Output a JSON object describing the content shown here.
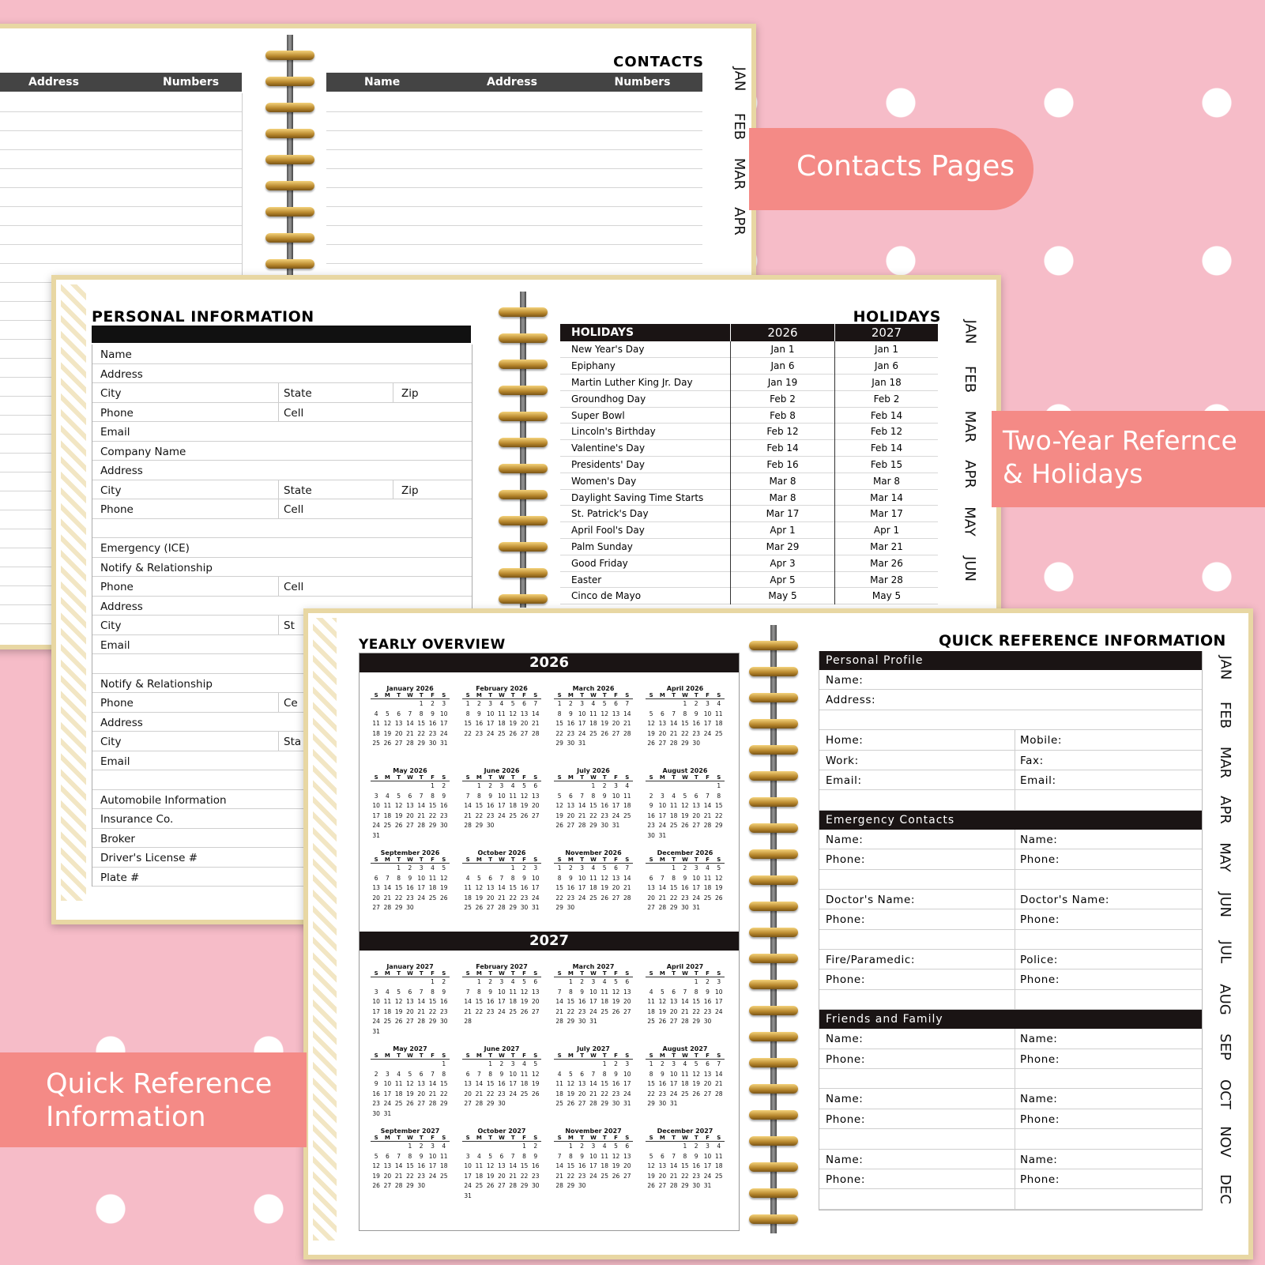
{
  "contacts_page": {
    "title": "CONTACTS",
    "left_headers": [
      "Address",
      "Numbers"
    ],
    "right_headers": [
      "Name",
      "Address",
      "Numbers"
    ]
  },
  "banners": {
    "contacts": "Contacts Pages",
    "holidays_line1": "Two-Year Refernce",
    "holidays_line2": "& Holidays",
    "quick_line1": "Quick Reference",
    "quick_line2": "Information"
  },
  "month_tabs": [
    "JAN",
    "FEB",
    "MAR",
    "APR",
    "MAY",
    "JUN",
    "JUL",
    "AUG",
    "SEP",
    "OCT",
    "NOV",
    "DEC"
  ],
  "personal_info": {
    "title": "PERSONAL INFORMATION",
    "rows": [
      [
        "Name",
        "",
        ""
      ],
      [
        "Address",
        "",
        ""
      ],
      [
        "City",
        "State",
        "Zip"
      ],
      [
        "Phone",
        "Cell",
        ""
      ],
      [
        "Email",
        "",
        ""
      ],
      [
        "Company Name",
        "",
        ""
      ],
      [
        "Address",
        "",
        ""
      ],
      [
        "City",
        "State",
        "Zip"
      ],
      [
        "Phone",
        "Cell",
        ""
      ],
      [
        "",
        "",
        ""
      ],
      [
        "Emergency (ICE)",
        "",
        ""
      ],
      [
        "Notify & Relationship",
        "",
        ""
      ],
      [
        "Phone",
        "Cell",
        ""
      ],
      [
        "Address",
        "",
        ""
      ],
      [
        "City",
        "St",
        ""
      ],
      [
        "Email",
        "",
        ""
      ],
      [
        "",
        "",
        ""
      ],
      [
        "Notify & Relationship",
        "",
        ""
      ],
      [
        "Phone",
        "Ce",
        ""
      ],
      [
        "Address",
        "",
        ""
      ],
      [
        "City",
        "Sta",
        ""
      ],
      [
        "Email",
        "",
        ""
      ],
      [
        "",
        "",
        ""
      ],
      [
        "Automobile Information",
        "",
        ""
      ],
      [
        "Insurance Co.",
        "",
        ""
      ],
      [
        "Broker",
        "",
        ""
      ],
      [
        "Driver's License #",
        "",
        ""
      ],
      [
        "Plate #",
        "",
        ""
      ]
    ]
  },
  "holidays": {
    "title": "HOLIDAYS",
    "headers": [
      "HOLIDAYS",
      "2026",
      "2027"
    ],
    "rows": [
      [
        "New Year's Day",
        "Jan 1",
        "Jan 1"
      ],
      [
        "Epiphany",
        "Jan 6",
        "Jan 6"
      ],
      [
        "Martin Luther King Jr. Day",
        "Jan 19",
        "Jan 18"
      ],
      [
        "Groundhog Day",
        "Feb 2",
        "Feb 2"
      ],
      [
        "Super Bowl",
        "Feb 8",
        "Feb 14"
      ],
      [
        "Lincoln's Birthday",
        "Feb 12",
        "Feb 12"
      ],
      [
        "Valentine's Day",
        "Feb 14",
        "Feb 14"
      ],
      [
        "Presidents' Day",
        "Feb 16",
        "Feb 15"
      ],
      [
        "Women's Day",
        "Mar 8",
        "Mar 8"
      ],
      [
        "Daylight Saving Time Starts",
        "Mar 8",
        "Mar 14"
      ],
      [
        "St. Patrick's Day",
        "Mar 17",
        "Mar 17"
      ],
      [
        "April Fool's Day",
        "Apr 1",
        "Apr 1"
      ],
      [
        "Palm Sunday",
        "Mar 29",
        "Mar 21"
      ],
      [
        "Good Friday",
        "Apr 3",
        "Mar 26"
      ],
      [
        "Easter",
        "Apr 5",
        "Mar 28"
      ],
      [
        "Cinco de Mayo",
        "May 5",
        "May 5"
      ]
    ]
  },
  "yearly_overview": {
    "title": "YEARLY OVERVIEW",
    "weekday_letters": [
      "S",
      "M",
      "T",
      "W",
      "T",
      "F",
      "S"
    ],
    "years": [
      {
        "year": "2026",
        "months": [
          {
            "name": "January 2026",
            "start": 4,
            "days": 31
          },
          {
            "name": "February 2026",
            "start": 0,
            "days": 28
          },
          {
            "name": "March 2026",
            "start": 0,
            "days": 31
          },
          {
            "name": "April 2026",
            "start": 3,
            "days": 30
          },
          {
            "name": "May 2026",
            "start": 5,
            "days": 31
          },
          {
            "name": "June 2026",
            "start": 1,
            "days": 30
          },
          {
            "name": "July 2026",
            "start": 3,
            "days": 31
          },
          {
            "name": "August 2026",
            "start": 6,
            "days": 31
          },
          {
            "name": "September 2026",
            "start": 2,
            "days": 30
          },
          {
            "name": "October 2026",
            "start": 4,
            "days": 31
          },
          {
            "name": "November 2026",
            "start": 0,
            "days": 30
          },
          {
            "name": "December 2026",
            "start": 2,
            "days": 31
          }
        ]
      },
      {
        "year": "2027",
        "months": [
          {
            "name": "January 2027",
            "start": 5,
            "days": 31
          },
          {
            "name": "February 2027",
            "start": 1,
            "days": 28
          },
          {
            "name": "March 2027",
            "start": 1,
            "days": 31
          },
          {
            "name": "April 2027",
            "start": 4,
            "days": 30
          },
          {
            "name": "May 2027",
            "start": 6,
            "days": 31
          },
          {
            "name": "June 2027",
            "start": 2,
            "days": 30
          },
          {
            "name": "July 2027",
            "start": 4,
            "days": 31
          },
          {
            "name": "August 2027",
            "start": 0,
            "days": 31
          },
          {
            "name": "September 2027",
            "start": 3,
            "days": 30
          },
          {
            "name": "October 2027",
            "start": 5,
            "days": 31
          },
          {
            "name": "November 2027",
            "start": 1,
            "days": 30
          },
          {
            "name": "December 2027",
            "start": 3,
            "days": 31
          }
        ]
      }
    ]
  },
  "quick_ref": {
    "title": "QUICK REFERENCE INFORMATION",
    "sections": [
      {
        "header": "Personal Profile",
        "rows": [
          [
            "Name:",
            ""
          ],
          [
            "Address:",
            ""
          ],
          [
            "",
            ""
          ],
          [
            "Home:",
            "Mobile:"
          ],
          [
            "Work:",
            "Fax:"
          ],
          [
            "Email:",
            "Email:"
          ],
          [
            "",
            ""
          ]
        ]
      },
      {
        "header": "Emergency Contacts",
        "rows": [
          [
            "Name:",
            "Name:"
          ],
          [
            "Phone:",
            "Phone:"
          ],
          [
            "",
            ""
          ],
          [
            "Doctor's Name:",
            "Doctor's  Name:"
          ],
          [
            "Phone:",
            "Phone:"
          ],
          [
            "",
            ""
          ],
          [
            "Fire/Paramedic:",
            "Police:"
          ],
          [
            "Phone:",
            "Phone:"
          ],
          [
            "",
            ""
          ]
        ]
      },
      {
        "header": "Friends and Family",
        "rows": [
          [
            "Name:",
            "Name:"
          ],
          [
            "Phone:",
            "Phone:"
          ],
          [
            "",
            ""
          ],
          [
            "Name:",
            "Name:"
          ],
          [
            "Phone:",
            "Phone:"
          ],
          [
            "",
            ""
          ],
          [
            "Name:",
            "Name:"
          ],
          [
            "Phone:",
            "Phone:"
          ],
          [
            "",
            ""
          ]
        ]
      }
    ]
  }
}
